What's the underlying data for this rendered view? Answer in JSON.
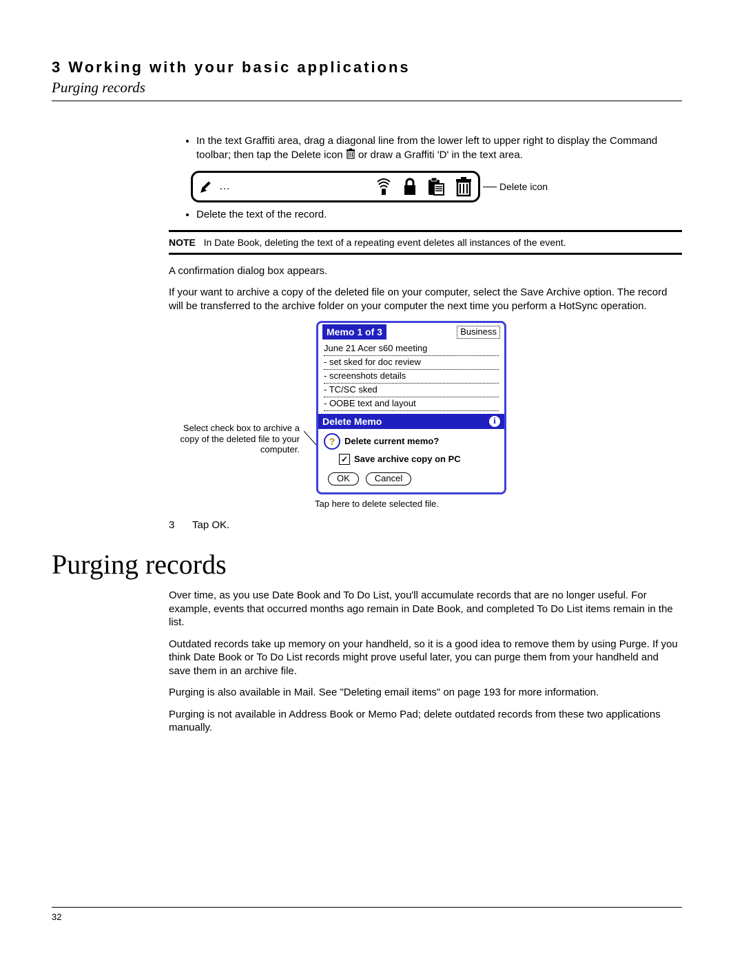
{
  "header": {
    "chapter_label": "3 Working with your basic applications",
    "subtitle": "Purging records"
  },
  "bullets": {
    "b1_pre": "In the text Graffiti area, drag a diagonal line from the lower left to upper right to display the Command toolbar; then tap the Delete icon ",
    "b1_post": " or draw a Graffiti 'D' in the text area.",
    "b2": "Delete the text of the record."
  },
  "toolbar_callout": "Delete icon",
  "note": {
    "label": "NOTE",
    "text": "In Date Book, deleting the text of a repeating event deletes all instances of the event."
  },
  "paras": {
    "p1": "A confirmation dialog box appears.",
    "p2": "If your want to archive a copy of the deleted file on your computer, select the Save Archive option. The record will be transferred to the archive folder on your computer the next time you perform a HotSync operation."
  },
  "memo": {
    "title": "Memo 1 of 3",
    "category": "Business",
    "lines": [
      "June 21 Acer s60 meeting",
      "- set sked for doc review",
      "- screenshots details",
      "- TC/SC sked",
      "- OOBE text and layout"
    ],
    "dialog_title": "Delete Memo",
    "dialog_question": "Delete current memo?",
    "dialog_check": "Save archive copy on PC",
    "ok": "OK",
    "cancel": "Cancel"
  },
  "annotations": {
    "left": "Select check box to archive a copy of the deleted file to your computer.",
    "below": "Tap here to delete selected file."
  },
  "step3": {
    "num": "3",
    "text": "Tap OK."
  },
  "section_heading": "Purging records",
  "section_paras": {
    "s1": "Over time, as you use Date Book and To Do List, you'll accumulate records that are no longer useful. For example, events that occurred months ago remain in Date Book, and completed To Do List items remain in the list.",
    "s2": "Outdated records take up memory on your handheld, so it is a good idea to remove them by using Purge. If you think Date Book or To Do List records might prove useful later, you can purge them from your handheld and save them in an archive file.",
    "s3": "Purging is also available in Mail. See \"Deleting email items\" on page 193 for more information.",
    "s4": "Purging is not available in Address Book or Memo Pad; delete outdated records from these two applications manually."
  },
  "page_number": "32"
}
